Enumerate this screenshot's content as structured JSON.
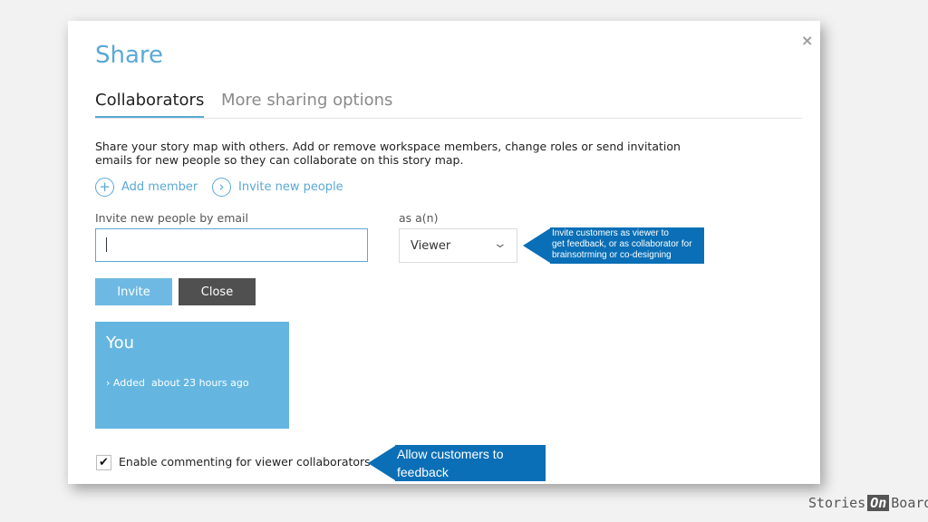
{
  "dialog": {
    "title": "Share",
    "close_icon": "×"
  },
  "tabs": [
    {
      "label": "Collaborators",
      "active": true
    },
    {
      "label": "More sharing options",
      "active": false
    }
  ],
  "description": "Share your story map with others. Add or remove workspace members, change roles or send invitation emails for new people so they can collaborate on this story map.",
  "actions": {
    "add_member": {
      "icon": "plus-icon",
      "glyph": "+",
      "label": "Add member"
    },
    "invite_new": {
      "icon": "chevron-right-icon",
      "glyph": "›",
      "label": "Invite new people"
    }
  },
  "invite_form": {
    "email_label": "Invite new people by email",
    "email_value": "",
    "role_label": "as a(n)",
    "role_value": "Viewer",
    "chevron_glyph": "⌄"
  },
  "buttons": {
    "invite": "Invite",
    "close": "Close"
  },
  "member": {
    "name": "You",
    "added_prefix": "›",
    "added": "Added  about 23 hours ago"
  },
  "commenting": {
    "checked": true,
    "check_glyph": "✔",
    "label": "Enable commenting for viewer collaborators"
  },
  "callouts": {
    "role_tip": [
      "Invite customers as viewer to",
      "get feedback, or as collaborator for",
      "brainsotrming or co-designing"
    ],
    "comment_tip": [
      "Allow customers to",
      "feedback"
    ]
  },
  "brand": {
    "part1": "Stories",
    "part2": "On",
    "part3": "Board"
  },
  "colors": {
    "accent": "#5aa9d6",
    "callout": "#0a6fb6",
    "card": "#64b6e1",
    "close_button": "#505050"
  }
}
